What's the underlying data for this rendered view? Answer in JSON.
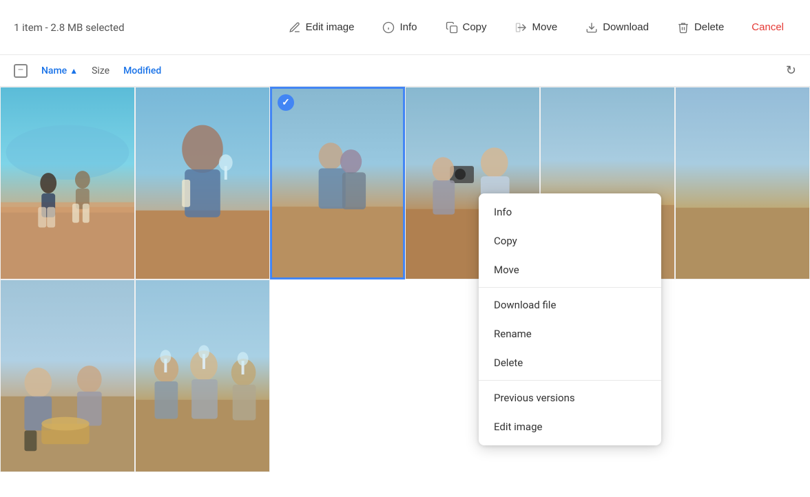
{
  "toolbar": {
    "selection_label": "1 item - 2.8 MB selected",
    "actions": [
      {
        "id": "edit-image",
        "label": "Edit image",
        "icon": "edit-image-icon"
      },
      {
        "id": "info",
        "label": "Info",
        "icon": "info-icon"
      },
      {
        "id": "copy",
        "label": "Copy",
        "icon": "copy-icon"
      },
      {
        "id": "move",
        "label": "Move",
        "icon": "move-icon"
      },
      {
        "id": "download",
        "label": "Download",
        "icon": "download-icon"
      },
      {
        "id": "delete",
        "label": "Delete",
        "icon": "delete-icon"
      },
      {
        "id": "cancel",
        "label": "Cancel",
        "icon": null,
        "style": "cancel"
      }
    ]
  },
  "column_headers": {
    "name_label": "Name",
    "sort_arrow": "▲",
    "size_label": "Size",
    "modified_label": "Modified"
  },
  "context_menu": {
    "items": [
      {
        "id": "ctx-info",
        "label": "Info",
        "divider_after": false
      },
      {
        "id": "ctx-copy",
        "label": "Copy",
        "divider_after": false
      },
      {
        "id": "ctx-move",
        "label": "Move",
        "divider_after": true
      },
      {
        "id": "ctx-download-file",
        "label": "Download file",
        "divider_after": false
      },
      {
        "id": "ctx-rename",
        "label": "Rename",
        "divider_after": false
      },
      {
        "id": "ctx-delete",
        "label": "Delete",
        "divider_after": true
      },
      {
        "id": "ctx-previous-versions",
        "label": "Previous versions",
        "divider_after": false
      },
      {
        "id": "ctx-edit-image",
        "label": "Edit image",
        "divider_after": false
      }
    ]
  },
  "grid": {
    "photos": [
      {
        "id": "photo-1",
        "class": "photo-1",
        "selected": false
      },
      {
        "id": "photo-2",
        "class": "photo-2",
        "selected": false
      },
      {
        "id": "photo-3",
        "class": "photo-3",
        "selected": true
      },
      {
        "id": "photo-4",
        "class": "photo-4",
        "selected": false
      },
      {
        "id": "photo-5",
        "class": "photo-5",
        "selected": false
      },
      {
        "id": "photo-6",
        "class": "photo-6",
        "selected": false
      },
      {
        "id": "photo-7",
        "class": "photo-7",
        "selected": false
      },
      {
        "id": "photo-8",
        "class": "photo-8",
        "selected": false
      }
    ]
  },
  "colors": {
    "accent": "#4285f4",
    "cancel": "#e53935",
    "text_primary": "#333",
    "text_secondary": "#555"
  }
}
